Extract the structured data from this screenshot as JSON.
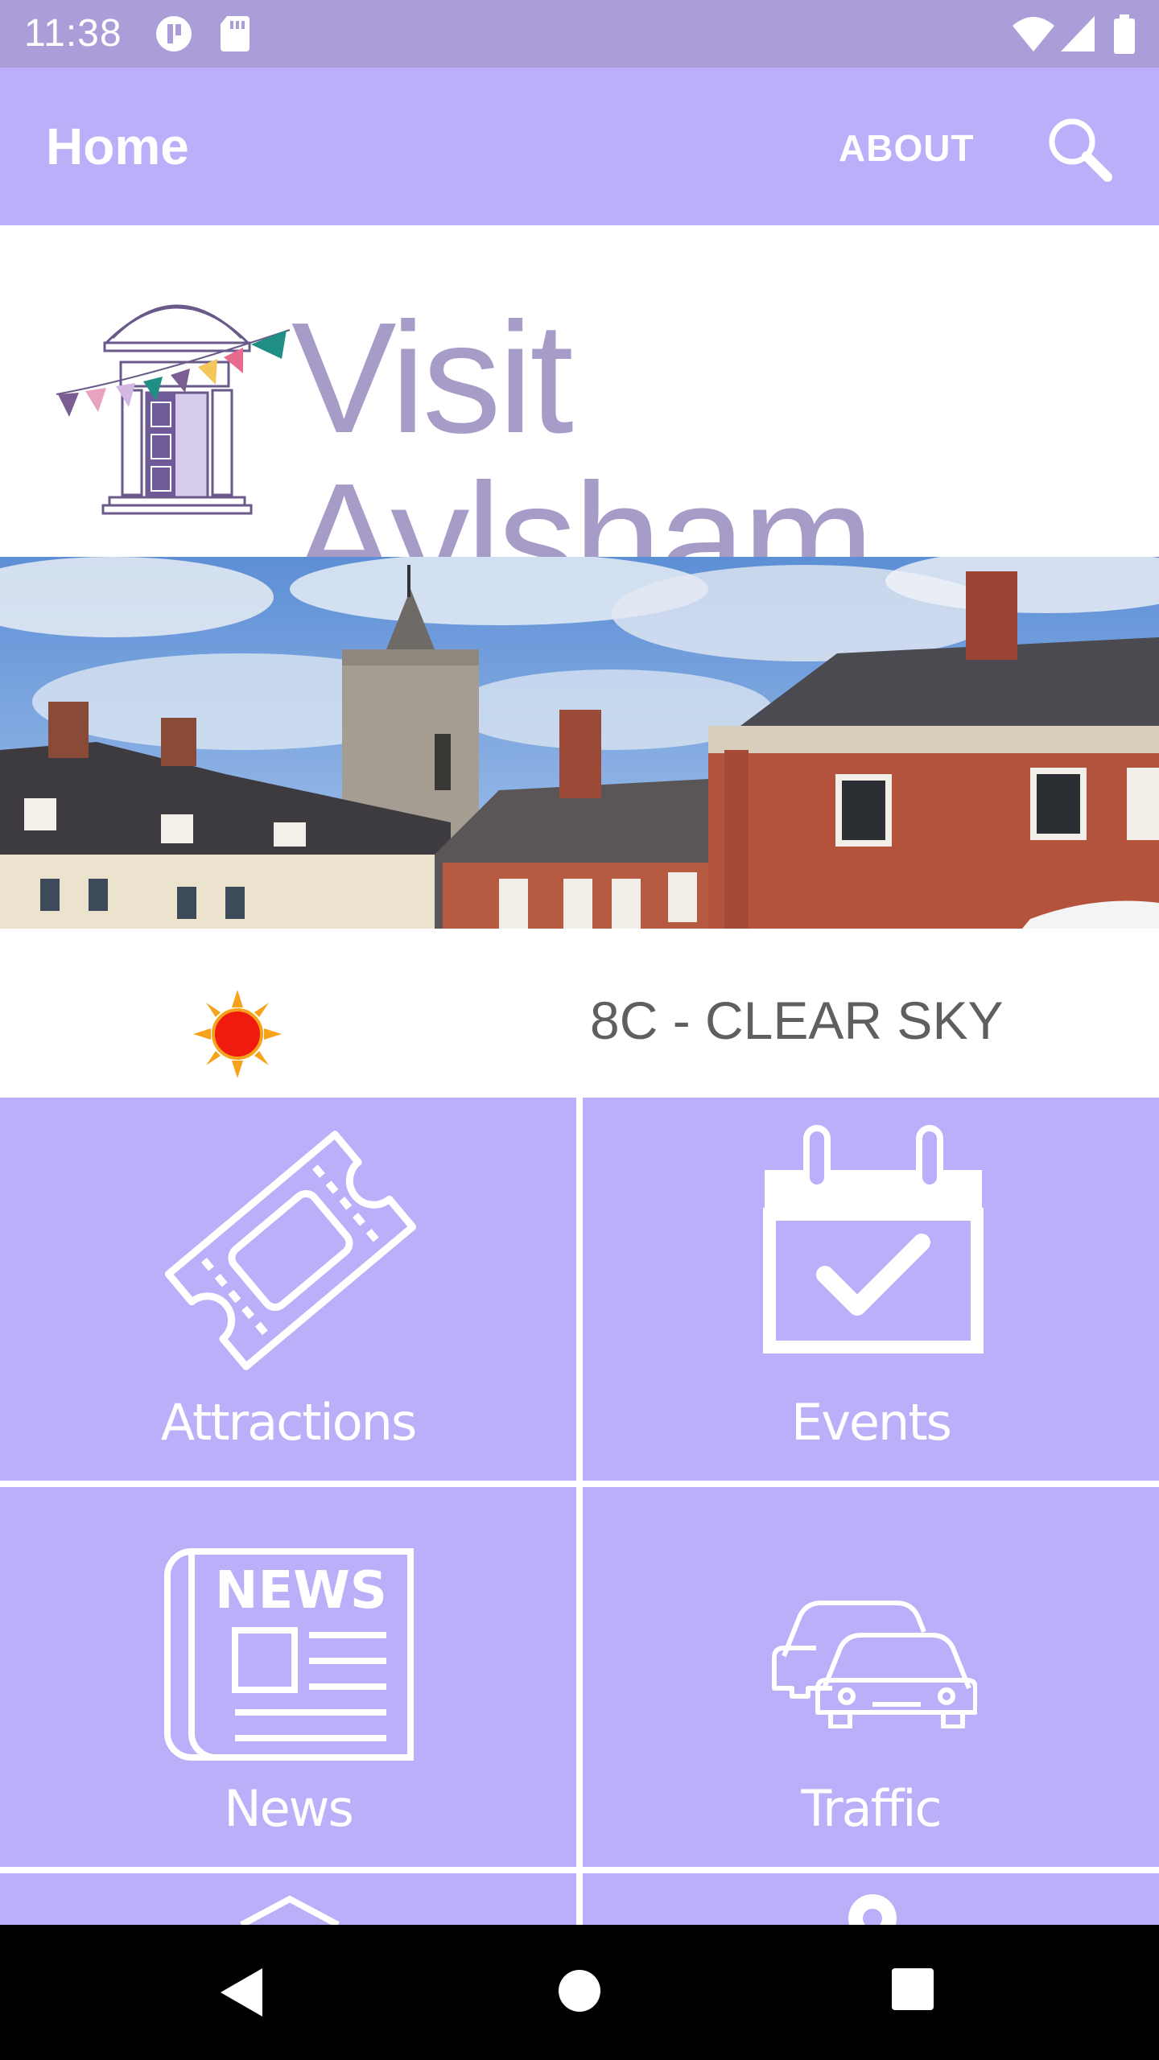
{
  "status_bar": {
    "time": "11:38",
    "icons": [
      "data-saver-icon",
      "sd-card-icon",
      "wifi-icon",
      "cell-signal-icon",
      "battery-icon"
    ]
  },
  "app_bar": {
    "title": "Home",
    "about_label": "ABOUT",
    "search_icon": "search-icon"
  },
  "logo": {
    "text": "Visit Aylsham"
  },
  "weather": {
    "icon": "sun-icon",
    "text": "8C - CLEAR SKY"
  },
  "tiles": [
    {
      "label": "Attractions",
      "icon": "ticket-icon"
    },
    {
      "label": "Events",
      "icon": "calendar-check-icon"
    },
    {
      "label": "News",
      "icon": "newspaper-icon"
    },
    {
      "label": "Traffic",
      "icon": "cars-icon"
    }
  ],
  "nav_bar": {
    "icons": [
      "back-icon",
      "home-icon",
      "recents-icon"
    ]
  },
  "colors": {
    "status_bar": "#ab9ed8",
    "app_bar": "#bcaef8",
    "tile": "#bcaef8",
    "logo_text": "#a79bc8",
    "weather_text": "#5f5f5f"
  }
}
